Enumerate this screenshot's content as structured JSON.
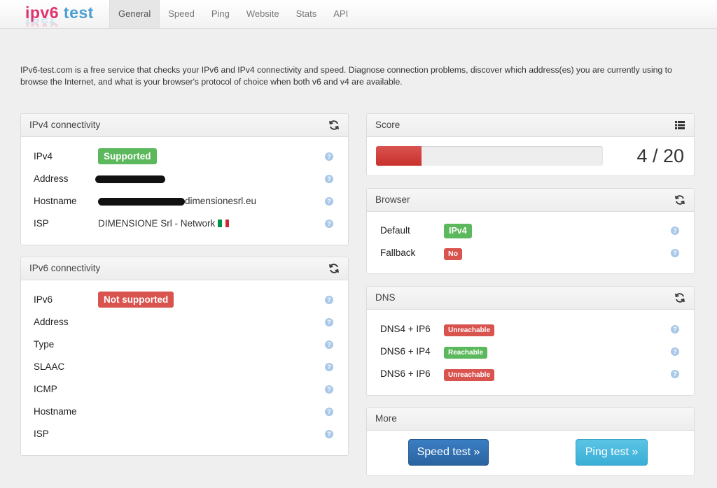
{
  "logo": {
    "part1": "ipv6",
    "part2": "test"
  },
  "nav": {
    "items": [
      {
        "label": "General",
        "active": true
      },
      {
        "label": "Speed"
      },
      {
        "label": "Ping"
      },
      {
        "label": "Website"
      },
      {
        "label": "Stats"
      },
      {
        "label": "API"
      }
    ]
  },
  "intro": "IPv6-test.com is a free service that checks your IPv6 and IPv4 connectivity and speed. Diagnose connection problems, discover which address(es) you are currently using to browse the Internet, and what is your browser's protocol of choice when both v6 and v4 are available.",
  "ipv4": {
    "title": "IPv4 connectivity",
    "rows": {
      "ipv4": {
        "label": "IPv4",
        "badge": "Supported"
      },
      "address": {
        "label": "Address"
      },
      "hostname": {
        "label": "Hostname",
        "value": "dimensionesrl.eu"
      },
      "isp": {
        "label": "ISP",
        "value": "DIMENSIONE Srl - Network"
      }
    }
  },
  "ipv6": {
    "title": "IPv6 connectivity",
    "rows": {
      "ipv6": {
        "label": "IPv6",
        "badge": "Not supported"
      },
      "address": {
        "label": "Address"
      },
      "type": {
        "label": "Type"
      },
      "slaac": {
        "label": "SLAAC"
      },
      "icmp": {
        "label": "ICMP"
      },
      "hostname": {
        "label": "Hostname"
      },
      "isp": {
        "label": "ISP"
      }
    }
  },
  "score": {
    "title": "Score",
    "value": "4 / 20",
    "fraction": 0.2
  },
  "browser": {
    "title": "Browser",
    "default": {
      "label": "Default",
      "badge": "IPv4"
    },
    "fallback": {
      "label": "Fallback",
      "badge": "No"
    }
  },
  "dns": {
    "title": "DNS",
    "rows": {
      "dns4_ip6": {
        "label": "DNS4 + IP6",
        "badge": "Unreachable"
      },
      "dns6_ip4": {
        "label": "DNS6 + IP4",
        "badge": "Reachable"
      },
      "dns6_ip6": {
        "label": "DNS6 + IP6",
        "badge": "Unreachable"
      }
    }
  },
  "more": {
    "title": "More",
    "speed_button": "Speed test »",
    "ping_button": "Ping test »"
  },
  "help_glyph": "?",
  "icons": {
    "refresh": "refresh-icon",
    "list": "list-icon",
    "help": "question-circle-icon",
    "flag": "italy-flag-icon"
  },
  "colors": {
    "success": "#5cb85c",
    "danger": "#d9534f",
    "primary": "#2f6fb0",
    "info": "#46b8da"
  }
}
